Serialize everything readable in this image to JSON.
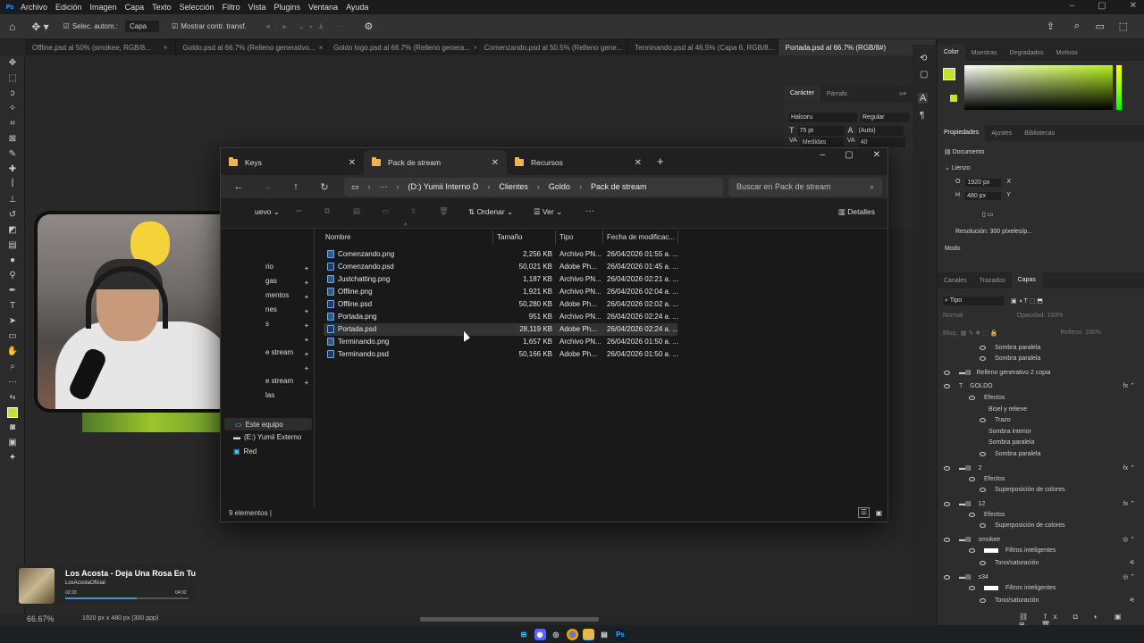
{
  "menubar": {
    "items": [
      "Archivo",
      "Edición",
      "Imagen",
      "Capa",
      "Texto",
      "Selección",
      "Filtro",
      "Vista",
      "Plugins",
      "Ventana",
      "Ayuda"
    ]
  },
  "options": {
    "auto_select": "Selec. autom.:",
    "layer": "Capa",
    "show_transform": "Mostrar contr. transf."
  },
  "doc_tabs": [
    {
      "label": "Offline.psd al 50% (smokee, RGB/8..."
    },
    {
      "label": "Goldo.psd al 66.7% (Relleno generativo..."
    },
    {
      "label": "Goldo logo.psd al 66.7% (Relleno genera..."
    },
    {
      "label": "Comenzando.psd al 50.5% (Relleno gene..."
    },
    {
      "label": "Terminando.psd al 46.5% (Capa 6, RGB/8..."
    },
    {
      "label": "Portada.psd al 66.7% (RGB/8#)"
    }
  ],
  "character": {
    "tab1": "Carácter",
    "tab2": "Párrafo",
    "font": "Halcoru",
    "style": "Regular",
    "size": "75 pt",
    "leading": "(Auto)",
    "kerning": "Medidas",
    "tracking": "40"
  },
  "color_panel": {
    "tabs": [
      "Color",
      "Muestras",
      "Degradados",
      "Motivos"
    ],
    "fg": "#c6e22a"
  },
  "properties": {
    "tabs": [
      "Propiedades",
      "Ajustes",
      "Bibliotecas"
    ],
    "doc": "Documento",
    "section": "Lienzo",
    "w_label": "O",
    "w": "1920 px",
    "x_label": "X",
    "h_label": "H",
    "h": "480 px",
    "y_label": "Y",
    "resolution": "Resolución: 300 píxeles/p...",
    "mode": "Modo"
  },
  "layers": {
    "tabs": [
      "Canales",
      "Trazados",
      "Capas"
    ],
    "filter": "Tipo",
    "blend": "Normal",
    "opacity_label": "Opacidad:",
    "opacity": "100%",
    "lock": "Bloq.:",
    "fill_label": "Relleno:",
    "fill": "100%",
    "rows": [
      "Sombra paralela",
      "Sombra paralela",
      "Relleno generativo 2 copia",
      "GOLDO",
      "Efectos",
      "Bisel y relieve",
      "Trazo",
      "Sombra interior",
      "Sombra paralela",
      "Sombra paralela",
      "2",
      "Efectos",
      "Superposición de colores",
      "12",
      "Efectos",
      "Superposición de colores",
      "smokee",
      "Filtros inteligentes",
      "Tono/saturación",
      "s34",
      "Filtros inteligentes",
      "Tono/saturación"
    ]
  },
  "explorer": {
    "tabs": [
      "Keys",
      "Pack de stream",
      "Recursos"
    ],
    "crumbs": [
      "(D:) Yumii Interno D",
      "Clientes",
      "Goldo",
      "Pack de stream"
    ],
    "search": "Buscar en Pack de stream",
    "cmd": {
      "new": "uevo",
      "sort": "Ordenar",
      "view": "Ver",
      "more": "···",
      "details": "Detalles"
    },
    "side": [
      "rio",
      "gas",
      "mentos",
      "nes",
      "s",
      "e stream",
      "",
      "e stream",
      "las",
      "Este equipo",
      "(E:) Yumii Externo",
      "Red"
    ],
    "columns": [
      "Nombre",
      "Tamaño",
      "Tipo",
      "Fecha de modificac..."
    ],
    "files": [
      {
        "name": "Comenzando.png",
        "size": "2,256 KB",
        "type": "Archivo PN...",
        "date": "26/04/2026 01:55 a. ..."
      },
      {
        "name": "Comenzando.psd",
        "size": "50,021 KB",
        "type": "Adobe Ph...",
        "date": "26/04/2026 01:45 a. ..."
      },
      {
        "name": "Justchatting.png",
        "size": "1,187 KB",
        "type": "Archivo PN...",
        "date": "26/04/2026 02:21 a. ..."
      },
      {
        "name": "Offline.png",
        "size": "1,921 KB",
        "type": "Archivo PN...",
        "date": "26/04/2026 02:04 a. ..."
      },
      {
        "name": "Offline.psd",
        "size": "50,280 KB",
        "type": "Adobe Ph...",
        "date": "26/04/2026 02:02 a. ..."
      },
      {
        "name": "Portada.png",
        "size": "951 KB",
        "type": "Archivo PN...",
        "date": "26/04/2026 02:24 a. ..."
      },
      {
        "name": "Portada.psd",
        "size": "28,119 KB",
        "type": "Adobe Ph...",
        "date": "26/04/2026 02:24 a. ..."
      },
      {
        "name": "Terminando.png",
        "size": "1,657 KB",
        "type": "Archivo PN...",
        "date": "26/04/2026 01:50 a. ..."
      },
      {
        "name": "Terminando.psd",
        "size": "50,166 KB",
        "type": "Adobe Ph...",
        "date": "26/04/2026 01:50 a. ..."
      }
    ],
    "status": "9 elementos"
  },
  "music": {
    "title": "Los Acosta - Deja Una Rosa En Tu",
    "artist": "LosAcostaOficial",
    "elapsed": "02:20",
    "total": "04:02",
    "progress": 0.58
  },
  "statusbar": {
    "zoom": "66.67%",
    "info": "1920 px x 480 px (300 ppp)"
  }
}
